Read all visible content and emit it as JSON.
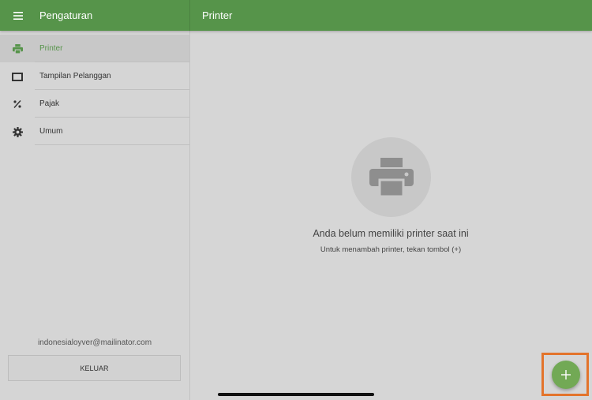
{
  "header": {
    "left_title": "Pengaturan",
    "right_title": "Printer",
    "menu_icon": "hamburger-menu-icon",
    "brand_color": "#56944a"
  },
  "sidebar": {
    "items": [
      {
        "label": "Printer",
        "icon": "printer-icon",
        "active": true
      },
      {
        "label": "Tampilan Pelanggan",
        "icon": "display-icon",
        "active": false
      },
      {
        "label": "Pajak",
        "icon": "percent-icon",
        "active": false
      },
      {
        "label": "Umum",
        "icon": "gear-icon",
        "active": false
      }
    ],
    "account_email": "indonesialoyver@mailinator.com",
    "logout_label": "KELUAR"
  },
  "main": {
    "empty_state": {
      "icon": "printer-icon",
      "title": "Anda belum memiliki printer saat ini",
      "subtitle": "Untuk menambah printer, tekan tombol (+)"
    },
    "fab": {
      "icon": "plus-icon",
      "color": "#72a955",
      "highlight_color": "#e3742b"
    }
  }
}
